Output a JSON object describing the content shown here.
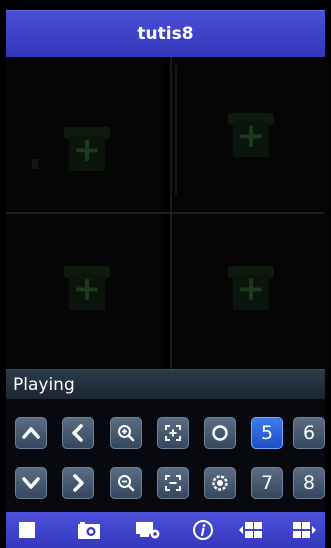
{
  "app": {
    "title": "tutis8"
  },
  "status": {
    "text": "Playing"
  },
  "channels": {
    "five": "5",
    "six": "6",
    "seven": "7",
    "eight": "8"
  },
  "icons": {
    "up": "chevron-up-icon",
    "left": "chevron-left-icon",
    "zoom_in": "zoom-in-icon",
    "focus_in": "focus-in-icon",
    "iris_open": "iris-open-icon",
    "down": "chevron-down-icon",
    "right": "chevron-right-icon",
    "zoom_out": "zoom-out-icon",
    "focus_out": "focus-out-icon",
    "iris_close": "iris-close-icon",
    "stop": "stop-icon",
    "snapshot": "camera-icon",
    "devices": "device-settings-icon",
    "info": "info-icon",
    "prev_group": "previous-group-icon",
    "next_group": "next-group-icon"
  },
  "colors": {
    "title_bar": "#3f43c8",
    "button": "#4a5d75",
    "active_button": "#2d63e0"
  }
}
